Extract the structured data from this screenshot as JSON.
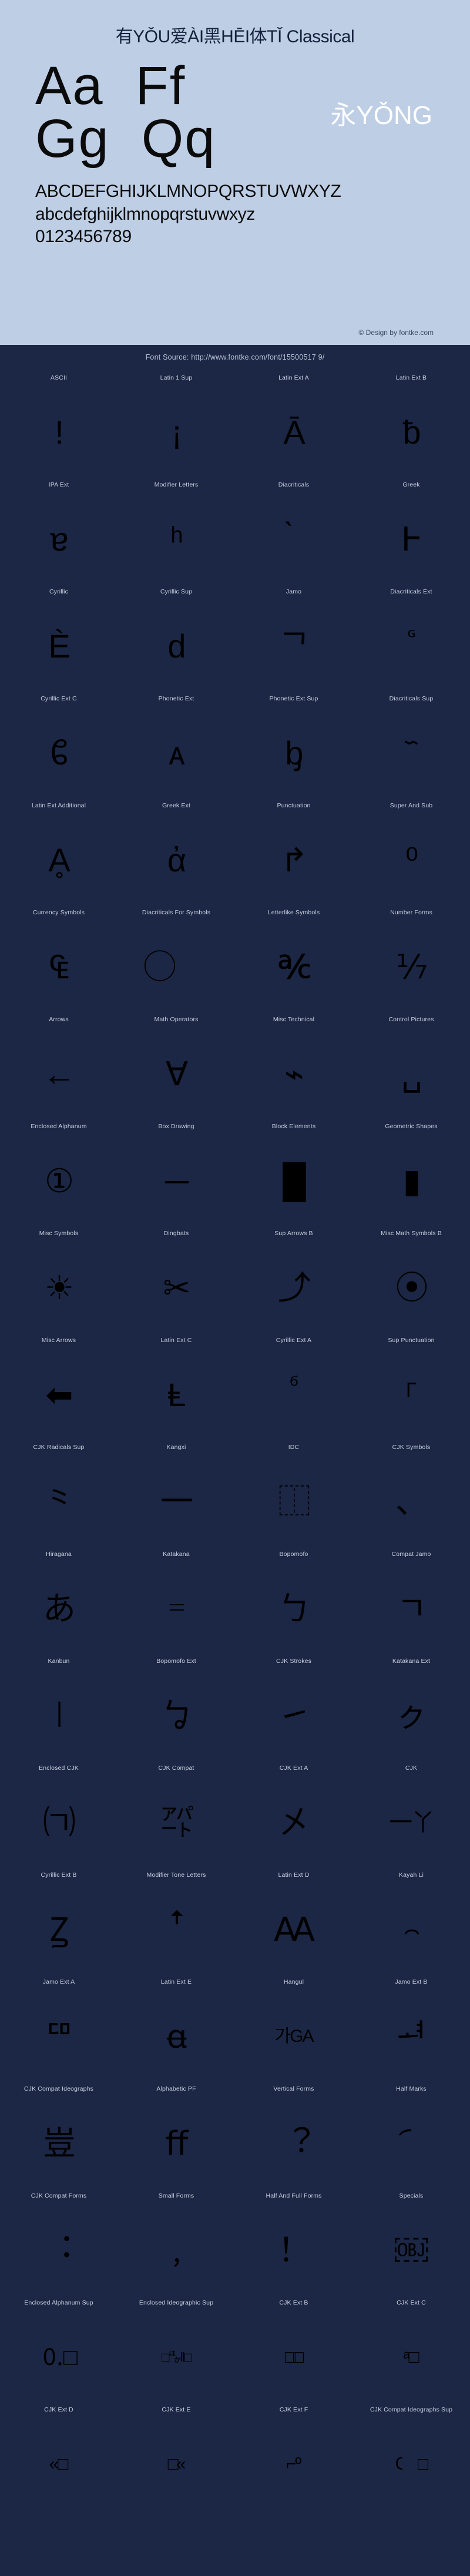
{
  "specimen": {
    "title": "有YǑU爱ÀI黑HĒI体TǏ Classical",
    "sample_rows": [
      "Aa",
      "Ff",
      "Gg",
      "Qq"
    ],
    "cjk_sample": "永YǑNG",
    "uppercase": "ABCDEFGHIJKLMNOPQRSTUVWXYZ",
    "lowercase": "abcdefghijklmnopqrstuvwxyz",
    "digits": "0123456789",
    "credit": "© Design by fontke.com",
    "colors": {
      "panel_bg": "#bdcee5",
      "map_bg": "#1b2744",
      "glyph": "#000000",
      "label": "#c6cfdf",
      "highlight": "#ffffff"
    }
  },
  "map": {
    "source": "Font Source: http://www.fontke.com/font/15500517 9/",
    "rows": [
      [
        {
          "label": "ASCII",
          "glyph": "!"
        },
        {
          "label": "Latin 1 Sup",
          "glyph": "¡"
        },
        {
          "label": "Latin Ext A",
          "glyph": "Ā"
        },
        {
          "label": "Latin Ext B",
          "glyph": "ƀ"
        }
      ],
      [
        {
          "label": "IPA Ext",
          "glyph": "ɐ"
        },
        {
          "label": "Modifier Letters",
          "glyph": "ʰ"
        },
        {
          "label": "Diacriticals",
          "glyph": "̀"
        },
        {
          "label": "Greek",
          "glyph": "Ͱ"
        }
      ],
      [
        {
          "label": "Cyrillic",
          "glyph": "Ѐ"
        },
        {
          "label": "Cyrillic Sup",
          "glyph": "ԁ"
        },
        {
          "label": "Jamo",
          "glyph": "ᄀ"
        },
        {
          "label": "Diacriticals Ext",
          "glyph": "ᷛ"
        }
      ],
      [
        {
          "label": "Cyrillic Ext C",
          "glyph": "ᲀ"
        },
        {
          "label": "Phonetic Ext",
          "glyph": "ᴀ"
        },
        {
          "label": "Phonetic Ext Sup",
          "glyph": "ᶀ"
        },
        {
          "label": "Diacriticals Sup",
          "glyph": "᷈"
        }
      ],
      [
        {
          "label": "Latin Ext Additional",
          "glyph": "Ḁ"
        },
        {
          "label": "Greek Ext",
          "glyph": "ἀ"
        },
        {
          "label": "Punctuation",
          "glyph": "↱"
        },
        {
          "label": "Super And Sub",
          "glyph": "⁰"
        }
      ],
      [
        {
          "label": "Currency Symbols",
          "glyph": "₠"
        },
        {
          "label": "Diacriticals For Symbols",
          "glyph": "⃝"
        },
        {
          "label": "Letterlike Symbols",
          "glyph": "℀"
        },
        {
          "label": "Number Forms",
          "glyph": "⅐"
        }
      ],
      [
        {
          "label": "Arrows",
          "glyph": "←"
        },
        {
          "label": "Math Operators",
          "glyph": "∀"
        },
        {
          "label": "Misc Technical",
          "glyph": "⌁"
        },
        {
          "label": "Control Pictures",
          "glyph": "␣"
        }
      ],
      [
        {
          "label": "Enclosed Alphanum",
          "glyph": "①"
        },
        {
          "label": "Box Drawing",
          "glyph": "─"
        },
        {
          "label": "Block Elements",
          "glyph": "█"
        },
        {
          "label": "Geometric Shapes",
          "glyph": "▮"
        }
      ],
      [
        {
          "label": "Misc Symbols",
          "glyph": "☀"
        },
        {
          "label": "Dingbats",
          "glyph": "✂"
        },
        {
          "label": "Sup Arrows B",
          "glyph": "⤴"
        },
        {
          "label": "Misc Math Symbols B",
          "glyph": "⦿"
        }
      ],
      [
        {
          "label": "Misc Arrows",
          "glyph": "⬅"
        },
        {
          "label": "Latin Ext C",
          "glyph": "Ⱡ"
        },
        {
          "label": "Cyrillic Ext A",
          "glyph": "ⷠ"
        },
        {
          "label": "Sup Punctuation",
          "glyph": "⸀"
        }
      ],
      [
        {
          "label": "CJK Radicals Sup",
          "glyph": "⺀"
        },
        {
          "label": "Kangxi",
          "glyph": "⼀"
        },
        {
          "label": "IDC",
          "glyph": "⿰"
        },
        {
          "label": "CJK Symbols",
          "glyph": "、"
        }
      ],
      [
        {
          "label": "Hiragana",
          "glyph": "あ"
        },
        {
          "label": "Katakana",
          "glyph": "゠"
        },
        {
          "label": "Bopomofo",
          "glyph": "ㄅ"
        },
        {
          "label": "Compat Jamo",
          "glyph": "ㄱ"
        }
      ],
      [
        {
          "label": "Kanbun",
          "glyph": "㆐"
        },
        {
          "label": "Bopomofo Ext",
          "glyph": "ㆠ"
        },
        {
          "label": "CJK Strokes",
          "glyph": "㇀"
        },
        {
          "label": "Katakana Ext",
          "glyph": "ㇰ"
        }
      ],
      [
        {
          "label": "Enclosed CJK",
          "glyph": "㈀"
        },
        {
          "label": "CJK Compat",
          "glyph": "㌀"
        },
        {
          "label": "CJK Ext A",
          "glyph": "㐅"
        },
        {
          "label": "CJK",
          "glyph": "一丫"
        }
      ],
      [
        {
          "label": "Cyrillic Ext B",
          "glyph": "Ꙁ"
        },
        {
          "label": "Modifier Tone Letters",
          "glyph": "ꜛ"
        },
        {
          "label": "Latin Ext D",
          "glyph": "Ꜳ"
        },
        {
          "label": "Kayah Li",
          "glyph": "꤮"
        }
      ],
      [
        {
          "label": "Jamo Ext A",
          "glyph": "ꥠ"
        },
        {
          "label": "Latin Ext E",
          "glyph": "ꬰ"
        },
        {
          "label": "Hangul",
          "glyph": "가GA"
        },
        {
          "label": "Jamo Ext B",
          "glyph": "ힰ"
        }
      ],
      [
        {
          "label": "CJK Compat Ideographs",
          "glyph": "豈"
        },
        {
          "label": "Alphabetic PF",
          "glyph": "ﬀ"
        },
        {
          "label": "Vertical Forms",
          "glyph": "︖"
        },
        {
          "label": "Half Marks",
          "glyph": "︠"
        }
      ],
      [
        {
          "label": "CJK Compat Forms",
          "glyph": "︓"
        },
        {
          "label": "Small Forms",
          "glyph": "﹐"
        },
        {
          "label": "Half And Full Forms",
          "glyph": "！"
        },
        {
          "label": "Specials",
          "glyph": "￼"
        }
      ],
      [
        {
          "label": "Enclosed Alphanum Sup",
          "glyph": "🄀□"
        },
        {
          "label": "Enclosed Ideographic Sup",
          "glyph": "□🈀‖□"
        },
        {
          "label": "CJK Ext B",
          "glyph": "□𠀀□"
        },
        {
          "label": "CJK Ext C",
          "glyph": "𪜀ᵃ□"
        }
      ],
      [
        {
          "label": "CJK Ext D",
          "glyph": "𫝀«□"
        },
        {
          "label": "CJK Ext E",
          "glyph": "□𫠠«"
        },
        {
          "label": "CJK Ext F",
          "glyph": "𬺰⌐º"
        },
        {
          "label": "CJK Compat Ideographs Sup",
          "glyph": "𖽐ᅟ□"
        }
      ]
    ]
  }
}
